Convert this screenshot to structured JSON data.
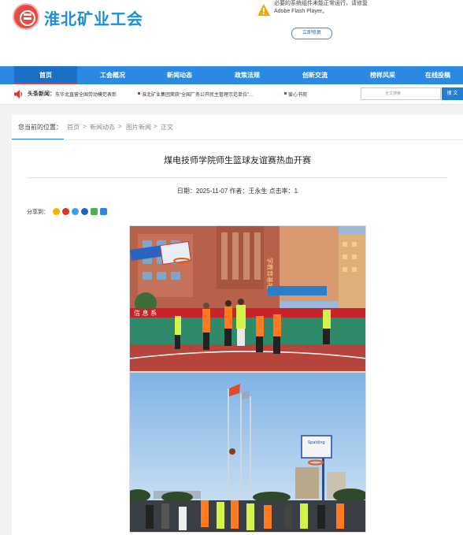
{
  "header": {
    "site_title": "淮北矿业工会",
    "flash_notice": "必要的系统组件未能正常运行，请修复 Adobe Flash Player。",
    "flash_button": "立即修复"
  },
  "nav": {
    "items": [
      {
        "label": "首页"
      },
      {
        "label": "工会概况"
      },
      {
        "label": "新闻动态"
      },
      {
        "label": "政策法规"
      },
      {
        "label": "创新交流"
      },
      {
        "label": "榜样风采"
      },
      {
        "label": "在线投稿"
      }
    ]
  },
  "headline_news": {
    "label": "头条新闻：",
    "items": [
      "东华北直营全国劳动模范表彰",
      "淮北矿业集团荣获“全国厂务公开民主管理示范单位”...",
      "爱心书苑"
    ]
  },
  "search": {
    "placeholder": "全文搜索",
    "button_label": "搜 文"
  },
  "breadcrumb": {
    "label": "您当前的位置：",
    "items": [
      "首页",
      "新闻动态",
      "图片新闻",
      "正文"
    ],
    "separator": ">"
  },
  "article": {
    "title": "煤电技师学院师生篮球友谊赛热血开赛",
    "meta": "日期：2025-11-07 作者：王永生 点击率：1",
    "share_label": "分享到："
  },
  "photos": {
    "photo1": {
      "building_sign": "学教育基地",
      "banner_text": "信 息 系"
    },
    "photo2": {
      "sign_text": "Spalding"
    }
  },
  "colors": {
    "brand_blue": "#1a8fd8",
    "nav_blue": "#2a8ae2",
    "active_red": "#e53935"
  }
}
